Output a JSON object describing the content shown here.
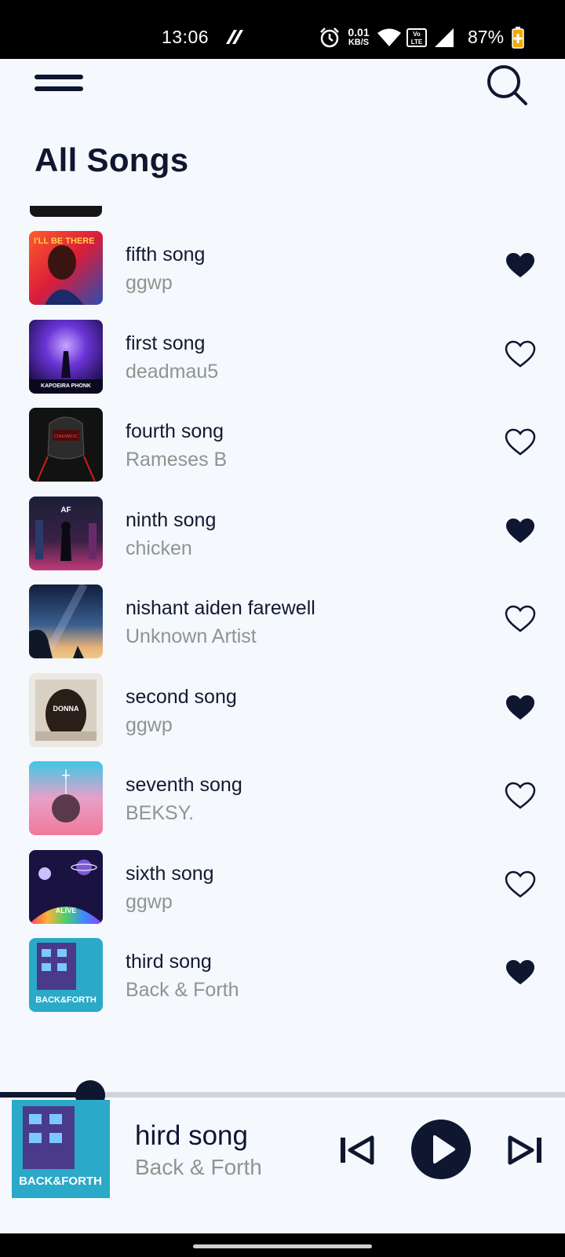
{
  "status_bar": {
    "time": "13:06",
    "net_speed_value": "0.01",
    "net_speed_unit": "KB/S",
    "battery": "87%"
  },
  "header": {
    "title": "All Songs",
    "menu_icon": "hamburger-menu-icon",
    "search_icon": "search-icon"
  },
  "songs": [
    {
      "title": "fifth song",
      "artist": "ggwp",
      "favorite": true,
      "art_caption": "I'LL BE THERE"
    },
    {
      "title": "first song",
      "artist": "deadmau5",
      "favorite": false,
      "art_caption": "KAPOEIRA PHONK"
    },
    {
      "title": "fourth song",
      "artist": "Rameses B",
      "favorite": false,
      "art_caption": "CINEMATIC"
    },
    {
      "title": "ninth song",
      "artist": "chicken",
      "favorite": true,
      "art_caption": "AF"
    },
    {
      "title": "nishant aiden farewell",
      "artist": "Unknown Artist",
      "favorite": false,
      "art_caption": ""
    },
    {
      "title": "second song",
      "artist": "ggwp",
      "favorite": true,
      "art_caption": "DONNA"
    },
    {
      "title": "seventh song",
      "artist": "BEKSY.",
      "favorite": false,
      "art_caption": ""
    },
    {
      "title": "sixth song",
      "artist": "ggwp",
      "favorite": false,
      "art_caption": "ALIVE"
    },
    {
      "title": "third song",
      "artist": "Back & Forth",
      "favorite": true,
      "art_caption": "BACK&FORTH"
    }
  ],
  "player": {
    "title": "hird song",
    "artist": "Back & Forth",
    "art_caption": "BACK&FORTH",
    "progress": 0.16,
    "controls": [
      "previous-icon",
      "play-icon",
      "next-icon"
    ]
  },
  "colors": {
    "background": "#f5f8fd",
    "primary": "#0e1630",
    "secondary_text": "#8c968f"
  }
}
